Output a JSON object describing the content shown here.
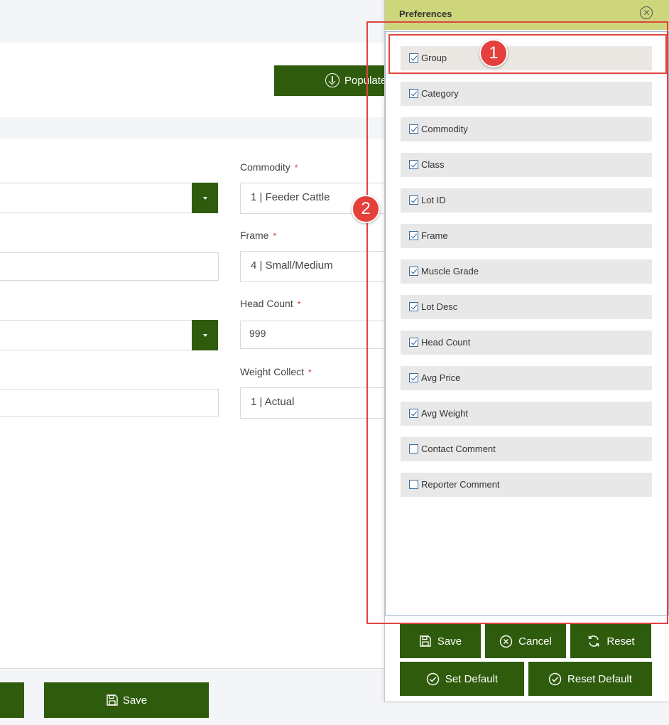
{
  "header": {
    "populate_label": "Populate"
  },
  "form": {
    "commodity": {
      "label": "Commodity",
      "required_mark": "*",
      "value": "1 | Feeder Cattle"
    },
    "frame": {
      "label": "Frame",
      "required_mark": "*",
      "value": "4 | Small/Medium"
    },
    "head_count": {
      "label": "Head Count",
      "required_mark": "*",
      "value": "999"
    },
    "weight_collect": {
      "label": "Weight Collect",
      "required_mark": "*",
      "value": "1 | Actual"
    }
  },
  "footer": {
    "save_label": "Save"
  },
  "preferences": {
    "title": "Preferences",
    "items": [
      {
        "label": "Group",
        "checked": true
      },
      {
        "label": "Category",
        "checked": true
      },
      {
        "label": "Commodity",
        "checked": true
      },
      {
        "label": "Class",
        "checked": true
      },
      {
        "label": "Lot ID",
        "checked": true
      },
      {
        "label": "Frame",
        "checked": true
      },
      {
        "label": "Muscle Grade",
        "checked": true
      },
      {
        "label": "Lot Desc",
        "checked": true
      },
      {
        "label": "Head Count",
        "checked": true
      },
      {
        "label": "Avg Price",
        "checked": true
      },
      {
        "label": "Avg Weight",
        "checked": true
      },
      {
        "label": "Contact Comment",
        "checked": false
      },
      {
        "label": "Reporter Comment",
        "checked": false
      }
    ],
    "buttons": {
      "save": "Save",
      "cancel": "Cancel",
      "reset": "Reset",
      "set_default": "Set Default",
      "reset_default": "Reset Default"
    }
  },
  "annotations": {
    "badge1": "1",
    "badge2": "2"
  }
}
